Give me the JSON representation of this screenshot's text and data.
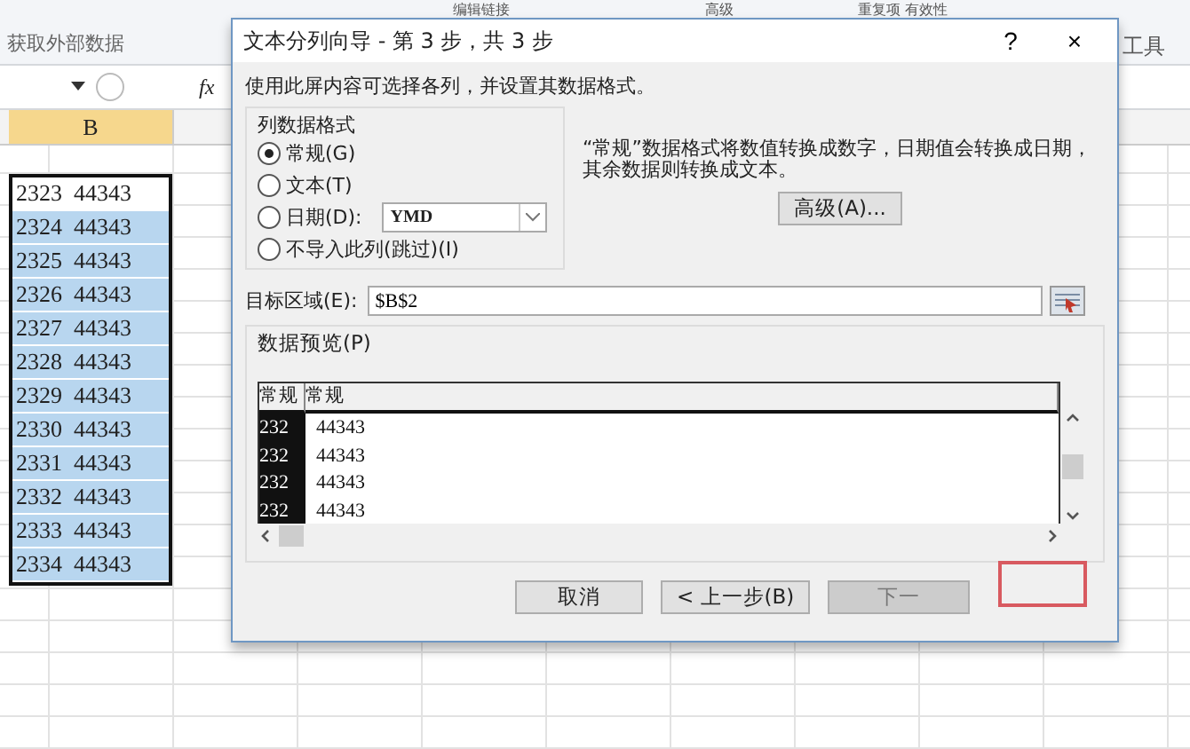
{
  "ribbon": {
    "top_items": [
      "编辑链接",
      "高级",
      "重复项 有效性"
    ],
    "group_label": "获取外部数据",
    "right_label": "工具"
  },
  "formula_bar": {
    "fx": "fx"
  },
  "sheet": {
    "column": "B",
    "column_selected": true,
    "cells": [
      {
        "text": "2323  44343",
        "selected": false
      },
      {
        "text": "2324  44343",
        "selected": true
      },
      {
        "text": "2325  44343",
        "selected": true
      },
      {
        "text": "2326  44343",
        "selected": true
      },
      {
        "text": "2327  44343",
        "selected": true
      },
      {
        "text": "2328  44343",
        "selected": true
      },
      {
        "text": "2329  44343",
        "selected": true
      },
      {
        "text": "2330  44343",
        "selected": true
      },
      {
        "text": "2331  44343",
        "selected": true
      },
      {
        "text": "2332  44343",
        "selected": true
      },
      {
        "text": "2333  44343",
        "selected": true
      },
      {
        "text": "2334  44343",
        "selected": true
      }
    ]
  },
  "dialog": {
    "title": "文本分列向导 - 第 3 步，共 3 步",
    "help": "?",
    "close": "×",
    "instruction": "使用此屏内容可选择各列，并设置其数据格式。",
    "format_group": {
      "title": "列数据格式",
      "options": [
        {
          "label": "常规(G)",
          "selected": true
        },
        {
          "label": "文本(T)",
          "selected": false
        },
        {
          "label": "日期(D):",
          "selected": false
        },
        {
          "label": "不导入此列(跳过)(I)",
          "selected": false
        }
      ],
      "date_format": "YMD"
    },
    "description": "“常规”数据格式将数值转换成数字，日期值会转换成日期，其余数据则转换成文本。",
    "advanced_button": "高级(A)...",
    "destination": {
      "label": "目标区域(E):",
      "value": "$B$2"
    },
    "preview": {
      "title": "数据预览(P)",
      "columns": [
        {
          "header": "常规",
          "selected": true,
          "cells": [
            "232",
            "232",
            "232",
            "232"
          ]
        },
        {
          "header": "常规",
          "selected": false,
          "cells": [
            "44343",
            "44343",
            "44343",
            "44343"
          ]
        }
      ]
    },
    "buttons": [
      {
        "label": "取消",
        "disabled": false
      },
      {
        "label": "< 上一步(B)",
        "disabled": false
      },
      {
        "label": "下一",
        "disabled": true
      }
    ],
    "finish_highlighted": true
  }
}
